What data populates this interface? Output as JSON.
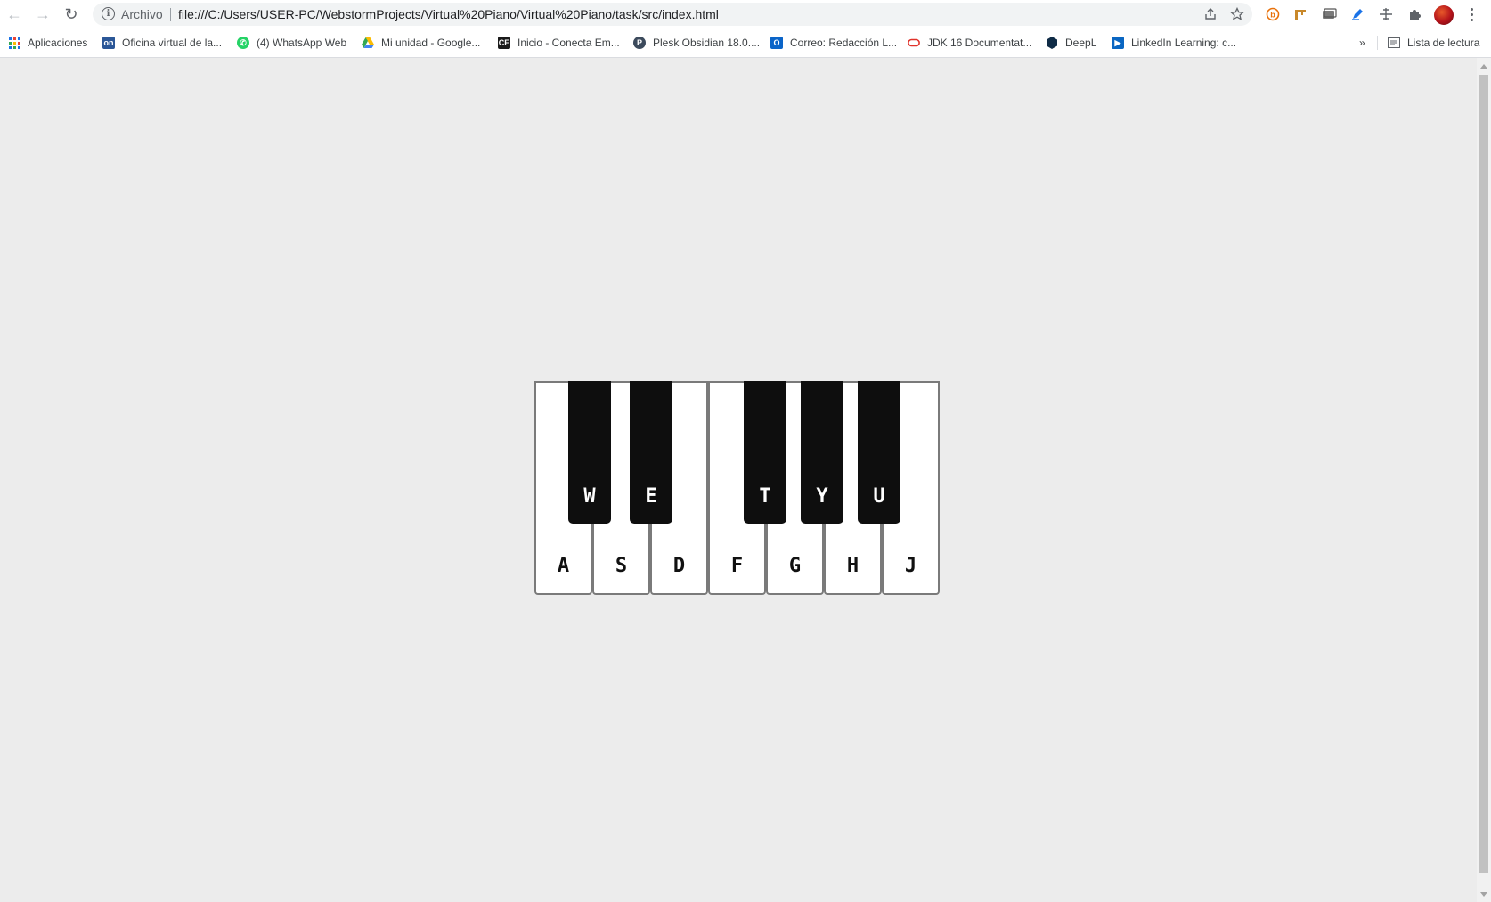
{
  "browser": {
    "scheme_label": "Archivo",
    "url": "file:///C:/Users/USER-PC/WebstormProjects/Virtual%20Piano/Virtual%20Piano/task/src/index.html",
    "nav": {
      "back_icon": "←",
      "forward_icon": "→",
      "reload_icon": "↻"
    },
    "bookmarks": [
      {
        "label": "Aplicaciones",
        "icon": "apps-grid-icon"
      },
      {
        "label": "Oficina virtual de la...",
        "icon": "oficina-icon",
        "icon_color": "#2b5797"
      },
      {
        "label": "(4) WhatsApp Web",
        "icon": "whatsapp-icon",
        "icon_color": "#25d366"
      },
      {
        "label": "Mi unidad - Google...",
        "icon": "google-drive-icon",
        "icon_color": "#fbbc04"
      },
      {
        "label": "Inicio - Conecta Em...",
        "icon": "conecta-icon",
        "icon_color": "#1a1a1a"
      },
      {
        "label": "Plesk Obsidian 18.0....",
        "icon": "plesk-icon",
        "icon_color": "#3c4a5c"
      },
      {
        "label": "Correo: Redacción L...",
        "icon": "outlook-icon",
        "icon_color": "#0a64c8"
      },
      {
        "label": "JDK 16 Documentat...",
        "icon": "oracle-icon",
        "icon_color": "#e0322a"
      },
      {
        "label": "DeepL",
        "icon": "deepl-icon",
        "icon_color": "#0f2b46"
      },
      {
        "label": "LinkedIn Learning: c...",
        "icon": "linkedin-learning-icon",
        "icon_color": "#0a66c2"
      }
    ],
    "more_bookmarks": "»",
    "reading_list": "Lista de lectura"
  },
  "piano": {
    "white_keys": [
      "A",
      "S",
      "D",
      "F",
      "G",
      "H",
      "J"
    ],
    "black_keys": [
      "W",
      "E",
      "T",
      "Y",
      "U"
    ]
  },
  "colors": {
    "page_background": "#ececec",
    "white_key": "#ffffff",
    "black_key": "#0e0e0e",
    "key_border": "#7a7a7a"
  }
}
